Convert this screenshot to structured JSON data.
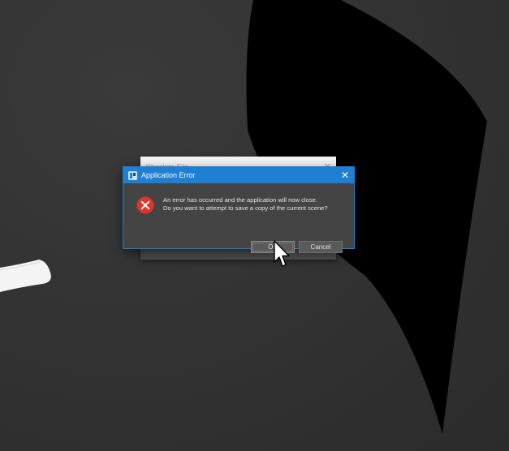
{
  "background_dialog": {
    "title": "Obsolete File",
    "close_glyph": "✕"
  },
  "error_dialog": {
    "title": "Application Error",
    "close_glyph": "✕",
    "app_icon": "app-icon",
    "status_icon": "error-circle-x-icon",
    "message_line1": "An error has occurred and the application will now close.",
    "message_line2": "Do you want to attempt to save a copy of the current scene?",
    "ok_label": "OK",
    "cancel_label": "Cancel"
  },
  "colors": {
    "accent": "#1f7fd2",
    "dialog_bg": "#444444",
    "error_red": "#e1322c"
  }
}
